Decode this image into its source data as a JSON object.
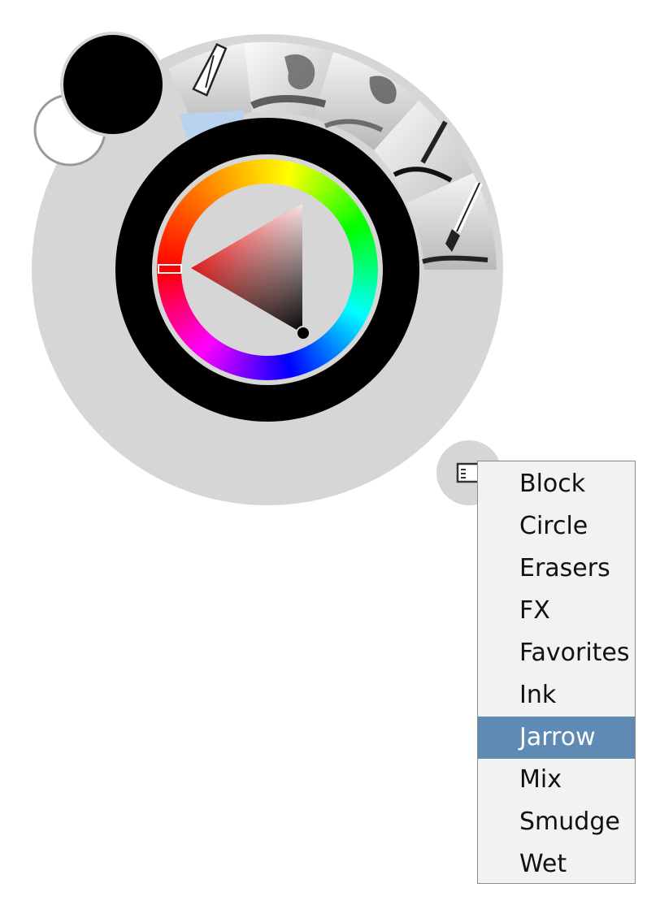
{
  "colors": {
    "primary_swatch": "#000000",
    "secondary_swatch": "#ffffff",
    "hue_marker": "#ff0000",
    "panel_background": "#d6d6d6",
    "selection_highlight": "#5f8ab3"
  },
  "brush_presets": [
    {
      "icon": "airbrush-icon"
    },
    {
      "icon": "chalk-stroke-icon"
    },
    {
      "icon": "pencil-texture-icon"
    },
    {
      "icon": "ink-pen-icon"
    },
    {
      "icon": "paint-brush-icon"
    }
  ],
  "library_button": {
    "icon": "library-list-icon"
  },
  "brush_library_menu": {
    "items": [
      {
        "label": "Block",
        "selected": false
      },
      {
        "label": "Circle",
        "selected": false
      },
      {
        "label": "Erasers",
        "selected": false
      },
      {
        "label": "FX",
        "selected": false
      },
      {
        "label": "Favorites",
        "selected": false
      },
      {
        "label": "Ink",
        "selected": false
      },
      {
        "label": "Jarrow",
        "selected": true
      },
      {
        "label": "Mix",
        "selected": false
      },
      {
        "label": "Smudge",
        "selected": false
      },
      {
        "label": "Wet",
        "selected": false
      }
    ]
  }
}
